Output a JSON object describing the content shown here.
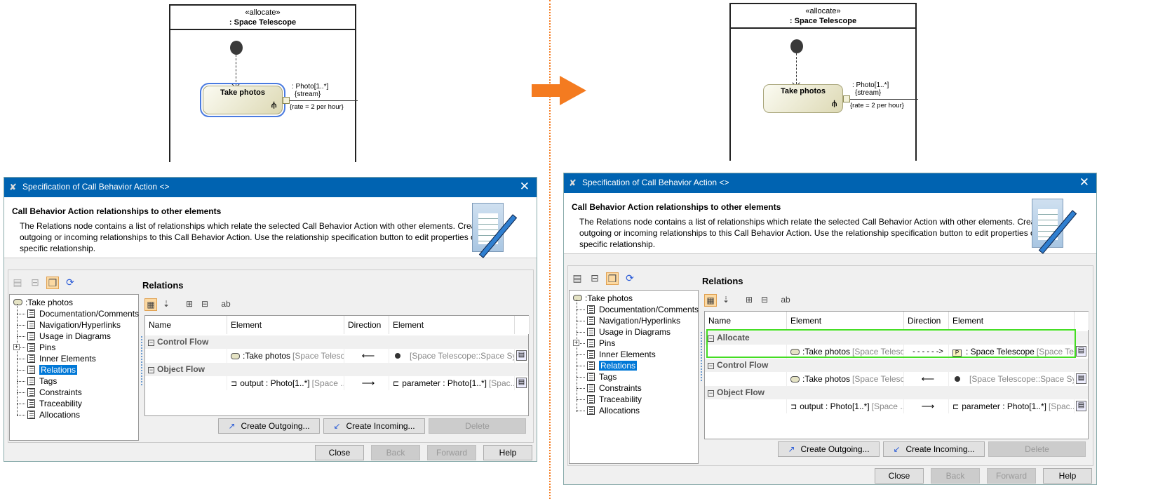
{
  "diagram": {
    "stereotype": "«allocate»",
    "part": ": Space Telescope",
    "action": "Take photos",
    "pin_label": ": Photo[1..*]",
    "pin_stream": "{stream}",
    "rate": "{rate = 2 per hour}"
  },
  "dialog": {
    "title": "Specification of Call Behavior Action <>",
    "heading": "Call Behavior Action relationships to other elements",
    "desc": [
      "The Relations node contains a list of relationships which relate the selected Call Behavior Action with other elements. Create",
      "outgoing or incoming relationships to this Call Behavior Action. Use the relationship specification button to edit properties of a",
      "specific relationship."
    ],
    "tree_root": ":Take photos",
    "tree": [
      "Documentation/Comments",
      "Navigation/Hyperlinks",
      "Usage in Diagrams",
      "Pins",
      "Inner Elements",
      "Relations",
      "Tags",
      "Constraints",
      "Traceability",
      "Allocations"
    ],
    "selected": "Relations",
    "section": "Relations",
    "columns": [
      "Name",
      "Element",
      "Direction",
      "Element"
    ],
    "actions": [
      "Create Outgoing...",
      "Create Incoming...",
      "Delete"
    ],
    "footer": [
      "Close",
      "Back",
      "Forward",
      "Help"
    ]
  },
  "panels": [
    {
      "groups": [
        {
          "name": "Control Flow",
          "el1": ":Take photos",
          "el1_owner": "[Space Telesc...",
          "dir": "⟵",
          "el2": "",
          "el2_owner": "[Space Telescope::Space Syst..."
        },
        {
          "name": "Object Flow",
          "el1": "output : Photo[1..*]",
          "el1_owner": "[Space ...",
          "dir": "⟶",
          "el2": "parameter : Photo[1..*]",
          "el2_owner": "[Spac..."
        }
      ]
    },
    {
      "groups": [
        {
          "name": "Allocate",
          "el1": ":Take photos",
          "el1_owner": "[Space Telesc...",
          "dir": "- - - - - ->",
          "el2": ": Space Telescope",
          "el2_owner": "[Space Tel..."
        },
        {
          "name": "Control Flow",
          "el1": ":Take photos",
          "el1_owner": "[Space Telesc...",
          "dir": "⟵",
          "el2": "",
          "el2_owner": "[Space Telescope::Space Syst..."
        },
        {
          "name": "Object Flow",
          "el1": "output : Photo[1..*]",
          "el1_owner": "[Space ...",
          "dir": "⟶",
          "el2": "parameter : Photo[1..*]",
          "el2_owner": "[Spac..."
        }
      ]
    }
  ],
  "colors": {
    "titlebar": "#0063b1",
    "highlight": "#44dd22",
    "arrow": "#f47b20"
  }
}
